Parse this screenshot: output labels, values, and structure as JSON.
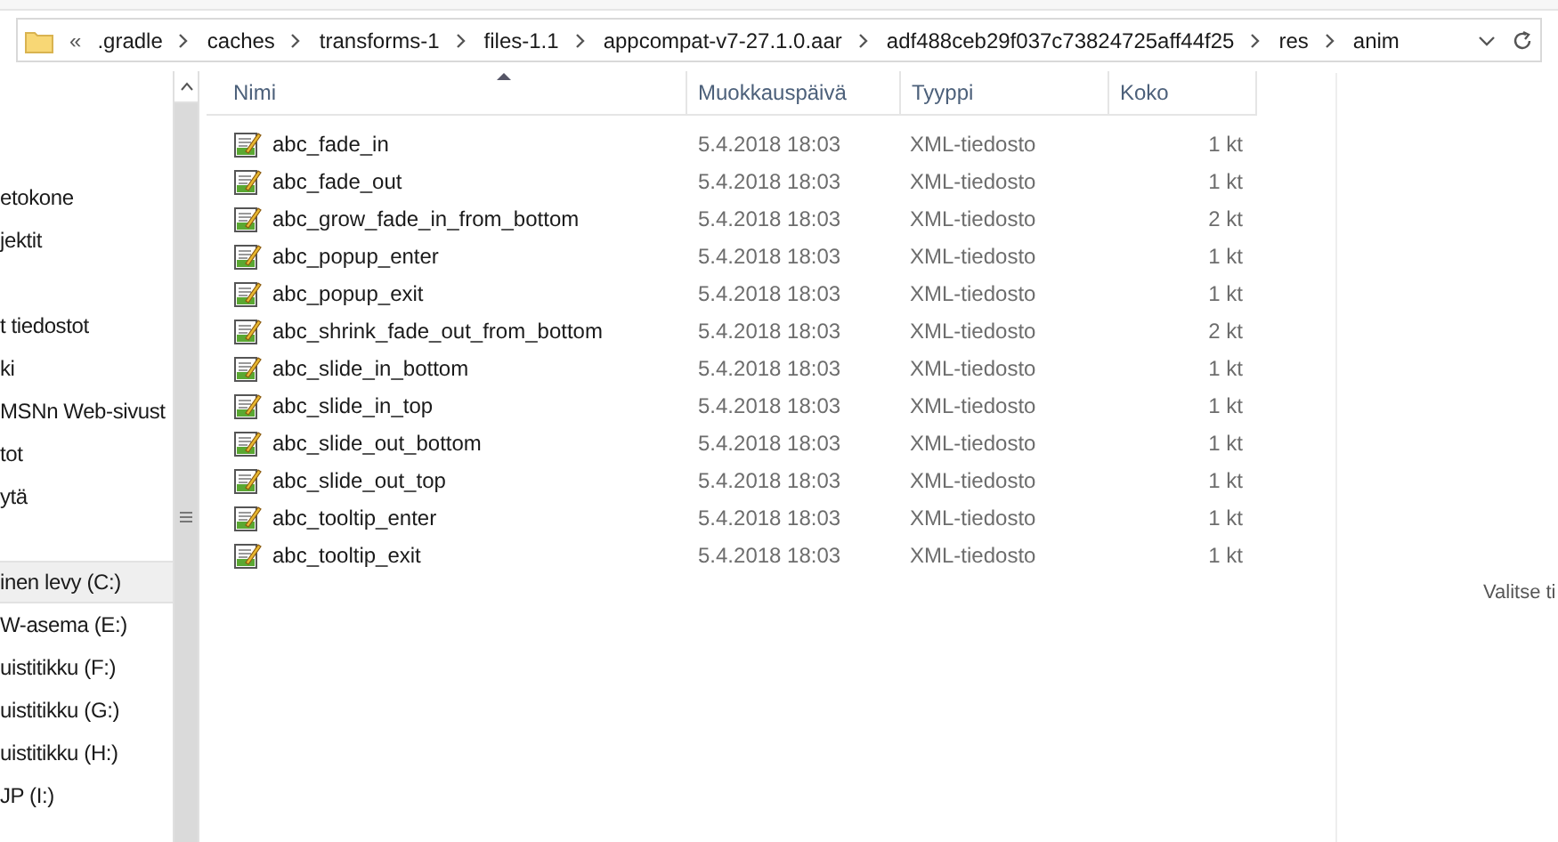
{
  "address_bar": {
    "overflow": "«",
    "crumbs": [
      ".gradle",
      "caches",
      "transforms-1",
      "files-1.1",
      "appcompat-v7-27.1.0.aar",
      "adf488ceb29f037c73824725aff44f25",
      "res",
      "anim"
    ]
  },
  "sidebar": {
    "groups": [
      [
        {
          "label": "etokone",
          "selected": false
        },
        {
          "label": "jektit",
          "selected": false
        }
      ],
      [
        {
          "label": "t tiedostot",
          "selected": false
        },
        {
          "label": "ki",
          "selected": false
        },
        {
          "label": "MSNn Web-sivust",
          "selected": false
        },
        {
          "label": "tot",
          "selected": false
        },
        {
          "label": "ytä",
          "selected": false
        }
      ],
      [
        {
          "label": "inen levy (C:)",
          "selected": true
        },
        {
          "label": "W-asema (E:)",
          "selected": false
        },
        {
          "label": "uistitikku (F:)",
          "selected": false
        },
        {
          "label": "uistitikku (G:)",
          "selected": false
        },
        {
          "label": "uistitikku (H:)",
          "selected": false
        },
        {
          "label": "JP (I:)",
          "selected": false
        }
      ]
    ]
  },
  "table": {
    "columns": [
      "Nimi",
      "Muokkauspäivä",
      "Tyyppi",
      "Koko"
    ],
    "rows": [
      {
        "name": "abc_fade_in",
        "modified": "5.4.2018 18:03",
        "type": "XML-tiedosto",
        "size": "1 kt"
      },
      {
        "name": "abc_fade_out",
        "modified": "5.4.2018 18:03",
        "type": "XML-tiedosto",
        "size": "1 kt"
      },
      {
        "name": "abc_grow_fade_in_from_bottom",
        "modified": "5.4.2018 18:03",
        "type": "XML-tiedosto",
        "size": "2 kt"
      },
      {
        "name": "abc_popup_enter",
        "modified": "5.4.2018 18:03",
        "type": "XML-tiedosto",
        "size": "1 kt"
      },
      {
        "name": "abc_popup_exit",
        "modified": "5.4.2018 18:03",
        "type": "XML-tiedosto",
        "size": "1 kt"
      },
      {
        "name": "abc_shrink_fade_out_from_bottom",
        "modified": "5.4.2018 18:03",
        "type": "XML-tiedosto",
        "size": "2 kt"
      },
      {
        "name": "abc_slide_in_bottom",
        "modified": "5.4.2018 18:03",
        "type": "XML-tiedosto",
        "size": "1 kt"
      },
      {
        "name": "abc_slide_in_top",
        "modified": "5.4.2018 18:03",
        "type": "XML-tiedosto",
        "size": "1 kt"
      },
      {
        "name": "abc_slide_out_bottom",
        "modified": "5.4.2018 18:03",
        "type": "XML-tiedosto",
        "size": "1 kt"
      },
      {
        "name": "abc_slide_out_top",
        "modified": "5.4.2018 18:03",
        "type": "XML-tiedosto",
        "size": "1 kt"
      },
      {
        "name": "abc_tooltip_enter",
        "modified": "5.4.2018 18:03",
        "type": "XML-tiedosto",
        "size": "1 kt"
      },
      {
        "name": "abc_tooltip_exit",
        "modified": "5.4.2018 18:03",
        "type": "XML-tiedosto",
        "size": "1 kt"
      }
    ]
  },
  "preview": {
    "message": "Valitse ti"
  }
}
